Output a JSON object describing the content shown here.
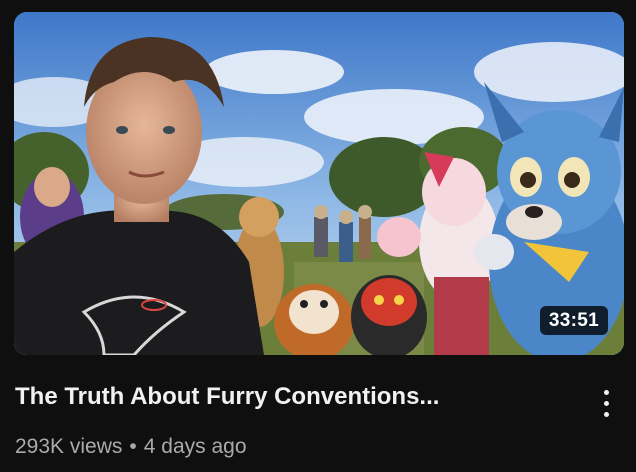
{
  "video": {
    "title": "The Truth About Furry Conventions...",
    "duration": "33:51",
    "views": "293K views",
    "separator": "•",
    "published": "4 days ago"
  },
  "icons": {
    "menu": "more-vert-icon"
  },
  "colors": {
    "background": "#0f0f0f",
    "title_text": "#f1f1f1",
    "meta_text": "#aaaaaa",
    "duration_badge": "#000000"
  }
}
